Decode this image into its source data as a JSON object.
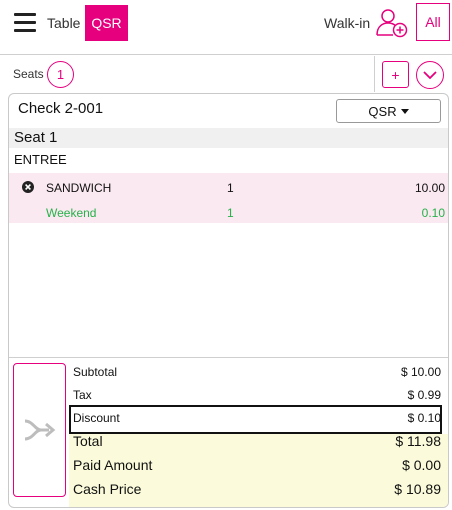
{
  "header": {
    "tab_table": "Table",
    "tab_qsr": "QSR",
    "walkin_label": "Walk-in",
    "all_button": "All",
    "icons": [
      "menu-icon",
      "add-guest-icon"
    ],
    "accent_color": "#e6007e"
  },
  "seats": {
    "label": "Seats",
    "current": "1",
    "add_label": "+"
  },
  "check": {
    "title": "Check 2-001",
    "mode_select": "QSR",
    "seat_label": "Seat 1",
    "course": "ENTREE",
    "items": [
      {
        "name": "SANDWICH",
        "qty": "1",
        "price": "10.00"
      }
    ],
    "modifiers": [
      {
        "name": "Weekend",
        "qty": "1",
        "price": "0.10",
        "color": "#25b24a"
      }
    ]
  },
  "totals": {
    "subtotal_label": "Subtotal",
    "subtotal": "$ 10.00",
    "tax_label": "Tax",
    "tax": "$ 0.99",
    "discount_label": "Discount",
    "discount": "$ 0.10",
    "total_label": "Total",
    "total": "$ 11.98",
    "paid_label": "Paid Amount",
    "paid": "$ 0.00",
    "cash_label": "Cash Price",
    "cash": "$ 10.89"
  }
}
